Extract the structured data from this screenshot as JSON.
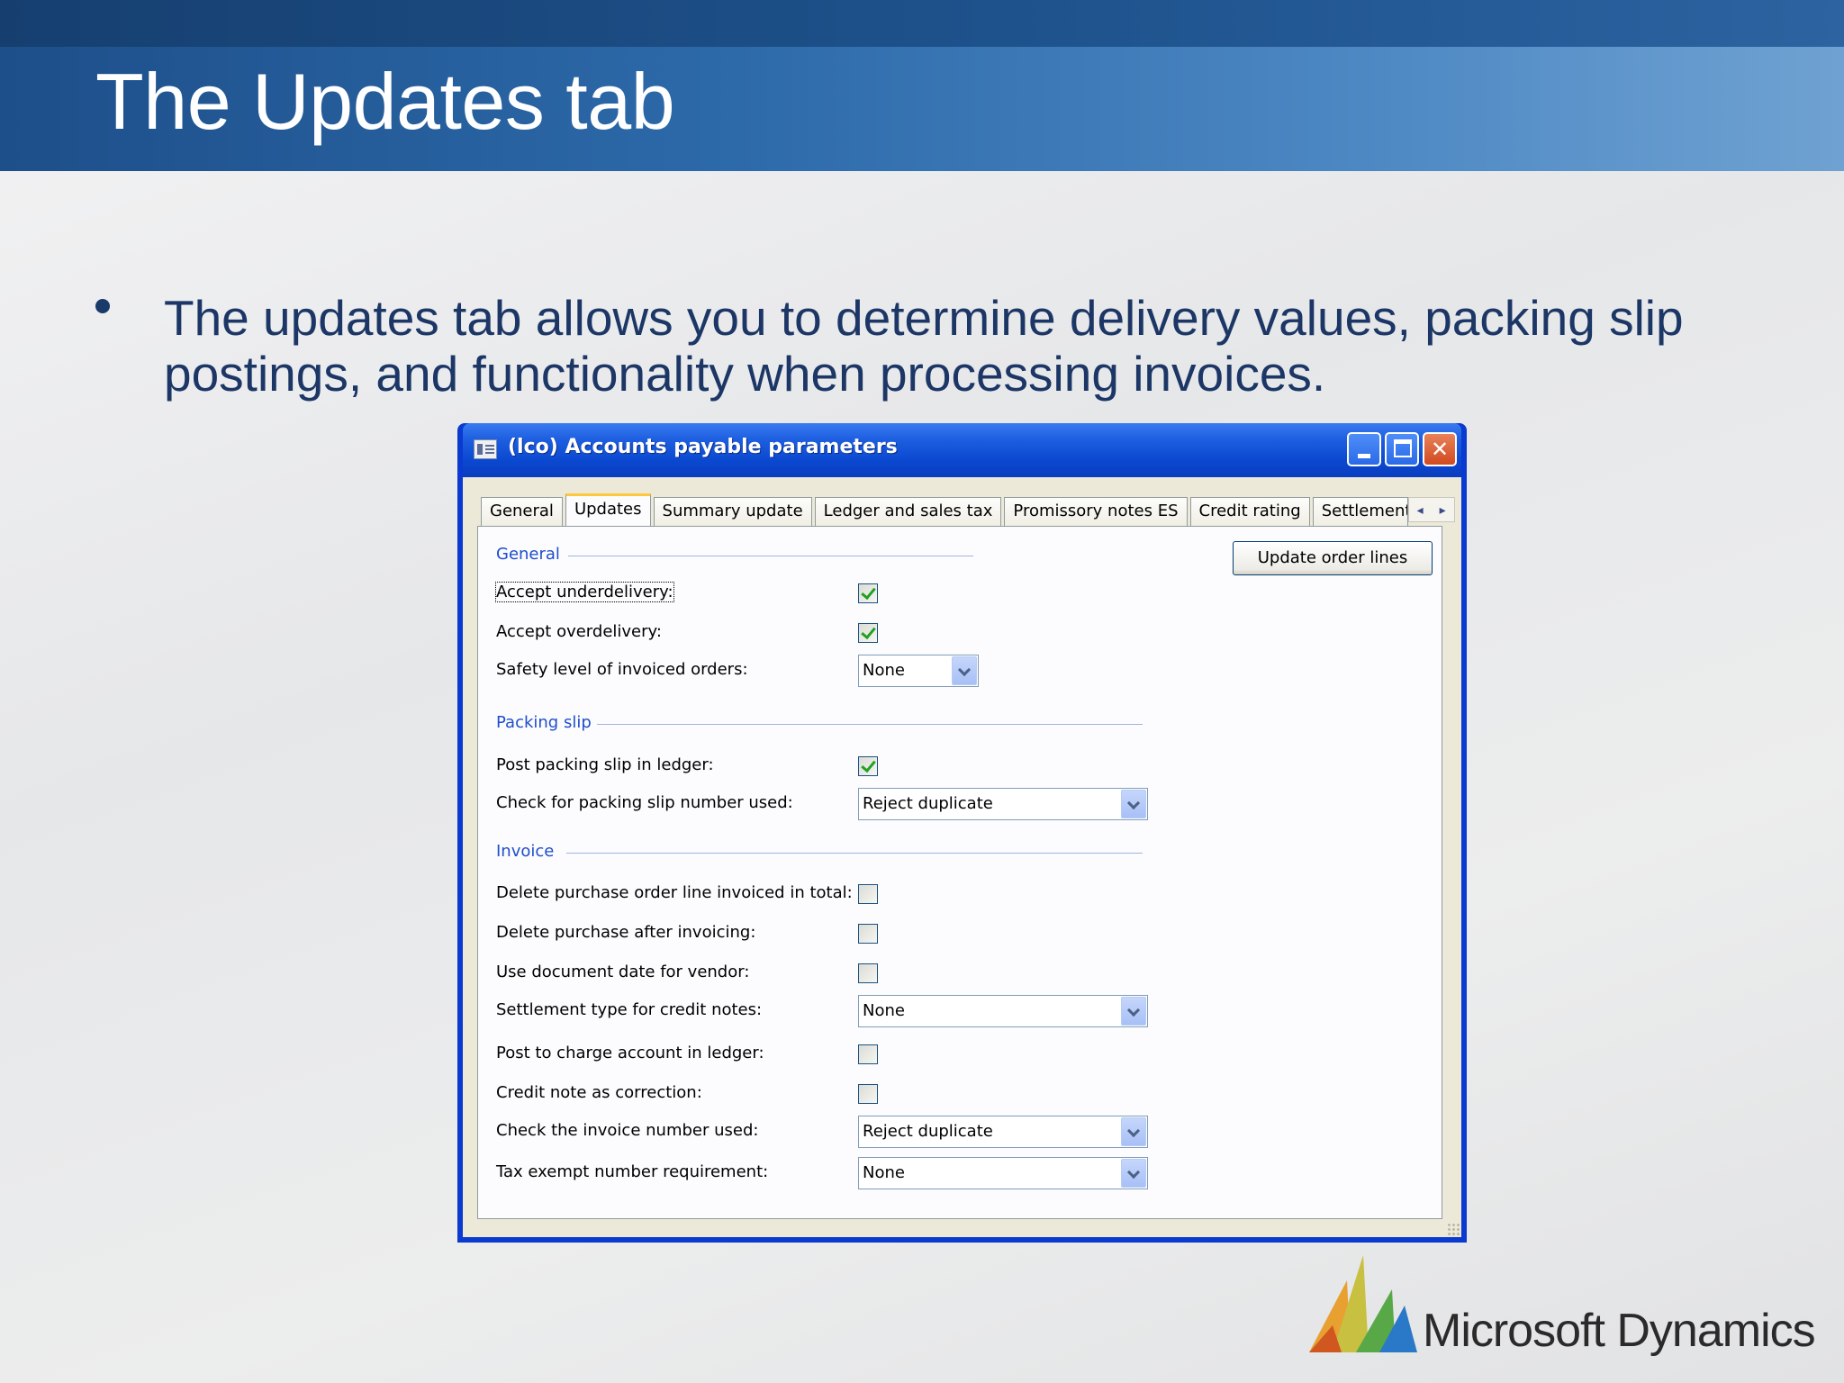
{
  "slide": {
    "title": "The Updates tab",
    "bullet": "The updates tab allows you to determine delivery values, packing slip postings, and functionality when processing invoices."
  },
  "window": {
    "title": "(lco) Accounts payable parameters",
    "controls": {
      "minimize": "minimize",
      "maximize": "maximize",
      "close": "close"
    }
  },
  "tabs": [
    {
      "label": "General",
      "active": false
    },
    {
      "label": "Updates",
      "active": true
    },
    {
      "label": "Summary update",
      "active": false
    },
    {
      "label": "Ledger and sales tax",
      "active": false
    },
    {
      "label": "Promissory notes ES",
      "active": false
    },
    {
      "label": "Credit rating",
      "active": false
    },
    {
      "label": "Settlement",
      "active": false
    }
  ],
  "action_button": "Update order lines",
  "groups": {
    "general": {
      "header": "General",
      "accept_underdelivery": {
        "label": "Accept underdelivery:",
        "checked": true
      },
      "accept_overdelivery": {
        "label": "Accept overdelivery:",
        "checked": true
      },
      "safety_level": {
        "label": "Safety level of invoiced orders:",
        "value": "None"
      }
    },
    "packing_slip": {
      "header": "Packing slip",
      "post_in_ledger": {
        "label": "Post packing slip in ledger:",
        "checked": true
      },
      "check_number": {
        "label": "Check for packing slip number used:",
        "value": "Reject duplicate"
      }
    },
    "invoice": {
      "header": "Invoice",
      "delete_line_invoiced": {
        "label": "Delete purchase order line invoiced in total:",
        "checked": false
      },
      "delete_purchase": {
        "label": "Delete purchase after invoicing:",
        "checked": false
      },
      "use_doc_date": {
        "label": "Use document date for vendor:",
        "checked": false
      },
      "settlement_type": {
        "label": "Settlement type for credit notes:",
        "value": "None"
      },
      "post_charge": {
        "label": "Post to charge account in ledger:",
        "checked": false
      },
      "credit_correction": {
        "label": "Credit note as correction:",
        "checked": false
      },
      "check_invoice_number": {
        "label": "Check the invoice number used:",
        "value": "Reject duplicate"
      },
      "tax_exempt": {
        "label": "Tax exempt number requirement:",
        "value": "None"
      }
    }
  },
  "logo": {
    "text": "Microsoft Dynamics"
  },
  "colors": {
    "title_band": "#2d6aaa",
    "bullet_text": "#1c3666",
    "group_header": "#1e4ecc",
    "xp_titlebar": "#0b48d0"
  }
}
